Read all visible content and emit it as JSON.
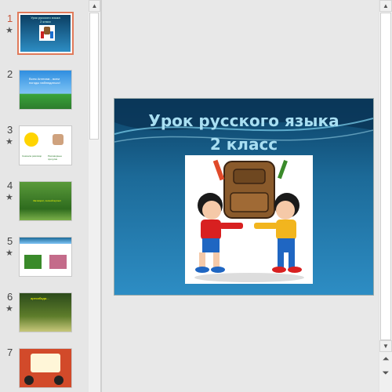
{
  "slides": [
    {
      "number": "1",
      "has_animation": true,
      "selected": true
    },
    {
      "number": "2",
      "has_animation": false,
      "selected": false
    },
    {
      "number": "3",
      "has_animation": true,
      "selected": false
    },
    {
      "number": "4",
      "has_animation": true,
      "selected": false
    },
    {
      "number": "5",
      "has_animation": true,
      "selected": false
    },
    {
      "number": "6",
      "has_animation": true,
      "selected": false
    },
    {
      "number": "7",
      "has_animation": false,
      "selected": false
    }
  ],
  "thumb_texts": {
    "slide1_line1": "Урок русского языка",
    "slide1_line2": "2 класс",
    "slide2": "Всем Ангелам - всем погоды наблюдаться!",
    "slide3_left": "Сначала разговор",
    "slide3_right": "Разговорные прогулки",
    "slide4": "Заговорит, лесной мутант",
    "slide6": "аресибадж..."
  },
  "main_slide": {
    "title_line1": "Урок русского языка",
    "title_line2": "2 класс"
  },
  "icons": {
    "animation_marker": "star-icon",
    "scroll_up": "triangle-up-icon",
    "scroll_down": "triangle-down-icon",
    "prev_slide": "double-up-icon",
    "next_slide": "double-down-icon"
  },
  "star_glyph": "★",
  "up_glyph": "▲",
  "down_glyph": "▼",
  "prev_glyph": "⏶",
  "next_glyph": "⏷"
}
